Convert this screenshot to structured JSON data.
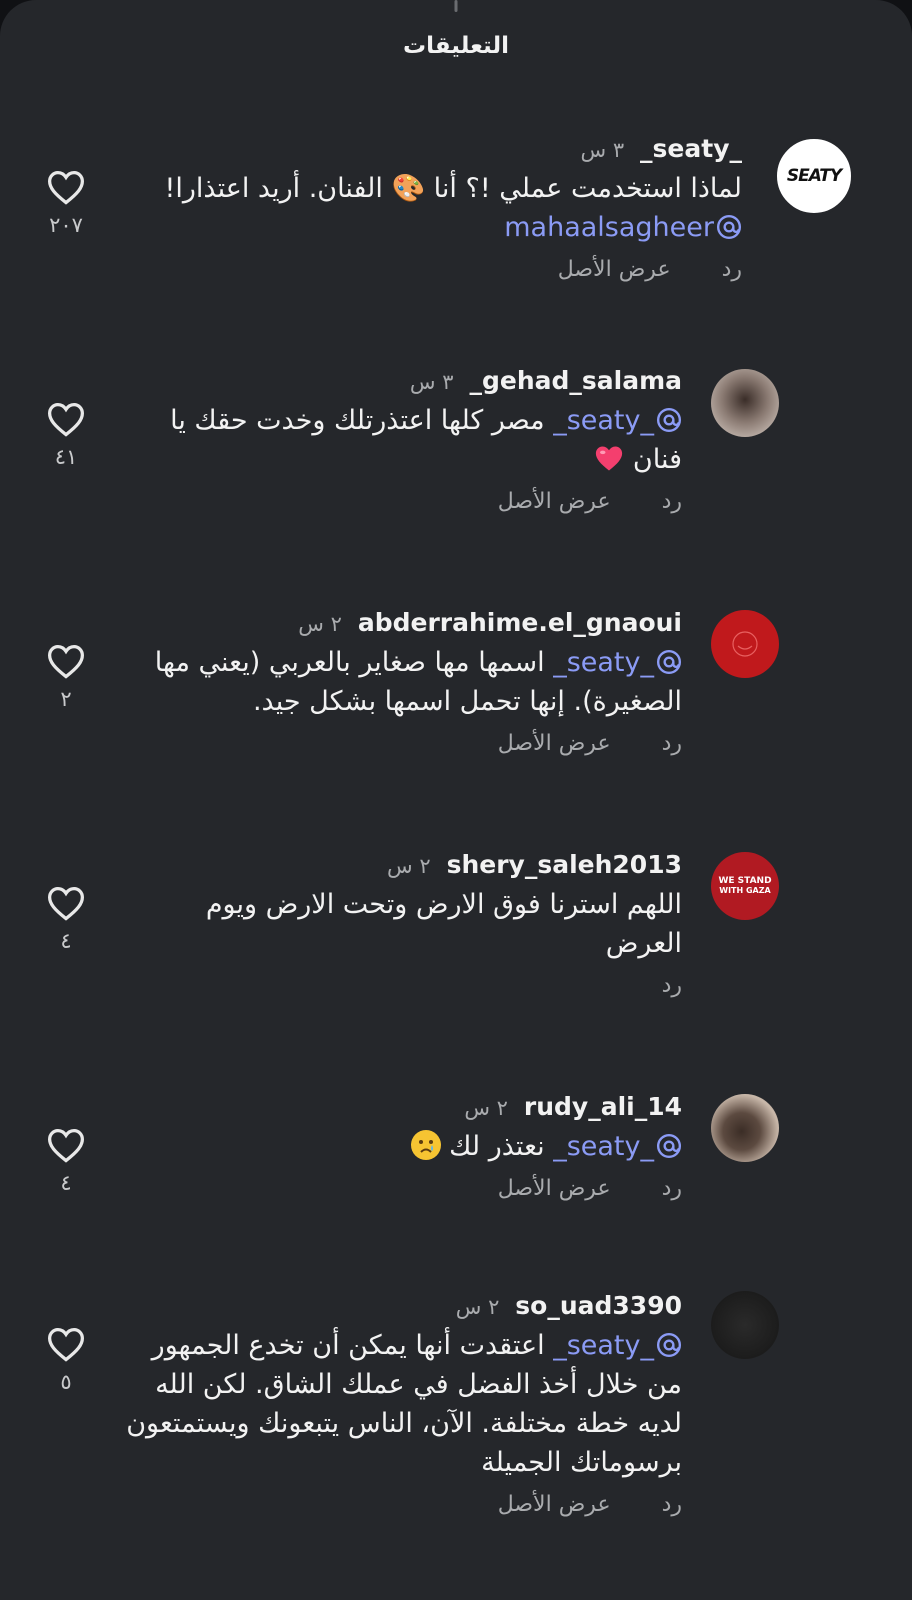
{
  "header": {
    "title": "التعليقات"
  },
  "comments": [
    {
      "username": "_seaty_",
      "time": "٣ س",
      "text_before": "لماذا استخدمت عملي !؟ أنا 🎨 الفنان. أريد اعتذارا!",
      "mention": "mahaalsagheer",
      "likes": "٢٠٧",
      "reply_label": "رد",
      "see_original_label": "عرض الأصل",
      "avatar_text": "SEATY"
    },
    {
      "username": "gehad_salama_",
      "time": "٣ س",
      "mention": "_seaty_",
      "text": "مصر كلها اعتذرتلك وخدت حقك يا فنان",
      "likes": "٤١",
      "reply_label": "رد",
      "see_original_label": "عرض الأصل"
    },
    {
      "username": "abderrahime.el_gnaoui",
      "time": "٢ س",
      "mention": "_seaty_",
      "text": "اسمها مها صغاير بالعربي (يعني مها الصغيرة). إنها تحمل اسمها بشكل جيد.",
      "likes": "٢",
      "reply_label": "رد",
      "see_original_label": "عرض الأصل"
    },
    {
      "username": "shery_saleh2013",
      "time": "٢ س",
      "text": "اللهم استرنا فوق الارض وتحت الارض ويوم العرض",
      "likes": "٤",
      "reply_label": "رد",
      "avatar_text_1": "WE STAND",
      "avatar_text_2": "WITH GAZA"
    },
    {
      "username": "rudy_ali_14",
      "time": "٢ س",
      "mention": "_seaty_",
      "text": "نعتذر لك",
      "likes": "٤",
      "reply_label": "رد",
      "see_original_label": "عرض الأصل"
    },
    {
      "username": "so_uad3390",
      "time": "٢ س",
      "mention": "_seaty_",
      "text": "اعتقدت أنها يمكن أن تخدع الجمهور من خلال أخذ الفضل في عملك الشاق. لكن الله لديه خطة مختلفة. الآن، الناس يتبعونك ويستمتعون برسوماتك الجميلة",
      "likes": "٥",
      "reply_label": "رد",
      "see_original_label": "عرض الأصل"
    }
  ],
  "icons": {
    "like": "heart-outline-icon",
    "mention": "threads-at-icon"
  },
  "colors": {
    "background": "#25272b",
    "mention": "#8b9bf5",
    "muted": "#a9abae"
  }
}
